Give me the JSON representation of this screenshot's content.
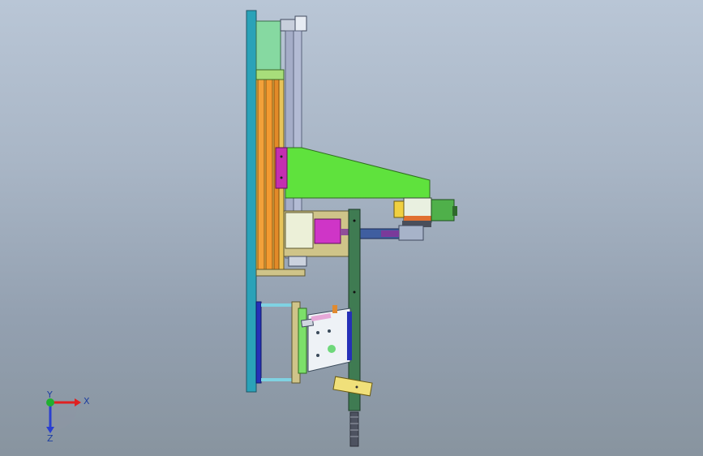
{
  "viewport": {
    "background_top": "#b9c6d6",
    "background_bottom": "#88949f"
  },
  "model": {
    "colors": {
      "base_plate": "#2aa2b8",
      "upper_block": "#86d9a1",
      "guide_rod": "#a5adc8",
      "spring_rail": "#f2a13a",
      "slide_frame": "#cfc489",
      "arm": "#5fe23d",
      "magenta_block": "#c42fb0",
      "cylinder": "#cf35c7",
      "column": "#3f7b52",
      "motor": "#4fb04a",
      "lower_frame": "#2530b8",
      "tilted_plate": "#eef2f6",
      "roller": "#f0e07a"
    }
  },
  "triad": {
    "x_label": "X",
    "y_label": "Y",
    "z_label": "Z",
    "x_color": "#e02020",
    "y_color": "#20b030",
    "z_color": "#2a3fd0"
  }
}
